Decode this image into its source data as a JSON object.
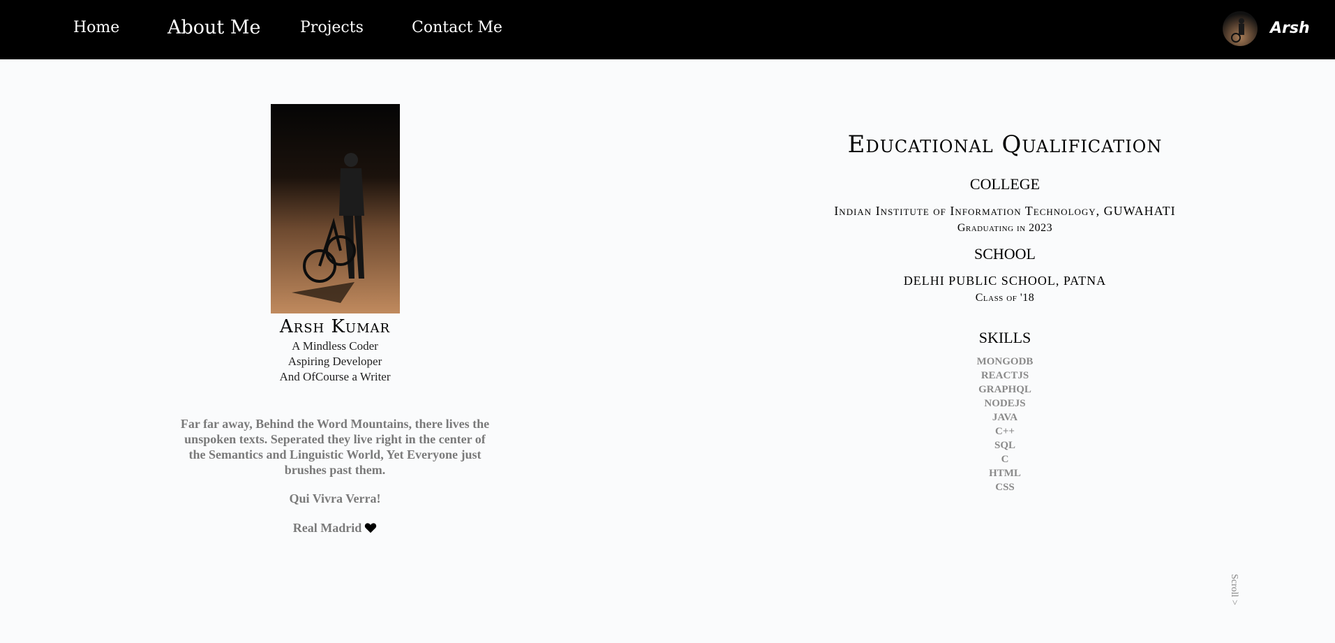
{
  "nav": {
    "links": [
      {
        "label": "Home"
      },
      {
        "label": "About Me"
      },
      {
        "label": "Projects"
      },
      {
        "label": "Contact Me"
      }
    ],
    "brand": "Arsh"
  },
  "profile": {
    "name": "Arsh Kumar",
    "taglines": [
      "A Mindless Coder",
      "Aspiring Developer",
      "And OfCourse a Writer"
    ],
    "bio": "Far far away, Behind the Word Mountains, there lives the unspoken texts. Seperated they live right in the center of the Semantics and Linguistic World, Yet Everyone just brushes past them.",
    "motto": "Qui Vivra Verra!",
    "club": "Real Madrid",
    "club_icon": "heart-icon"
  },
  "education": {
    "title": "Educational Qualification",
    "college_heading": "COLLEGE",
    "college_name": "Indian Institute of Information Technology, GUWAHATI",
    "college_detail": "Graduating in 2023",
    "school_heading": "SCHOOL",
    "school_name": "DELHI PUBLIC SCHOOL, PATNA",
    "school_detail": "Class of '18",
    "skills_heading": "SKILLS",
    "skills": [
      "MONGODB",
      "REACTJS",
      "GRAPHQL",
      "NODEJS",
      "JAVA",
      "C++",
      "SQL",
      "C",
      "HTML",
      "CSS"
    ]
  },
  "scroll_label": "Scroll >",
  "colors": {
    "navbar": "#000000",
    "background": "#fafbfc",
    "muted_text": "#7a7a7a"
  }
}
